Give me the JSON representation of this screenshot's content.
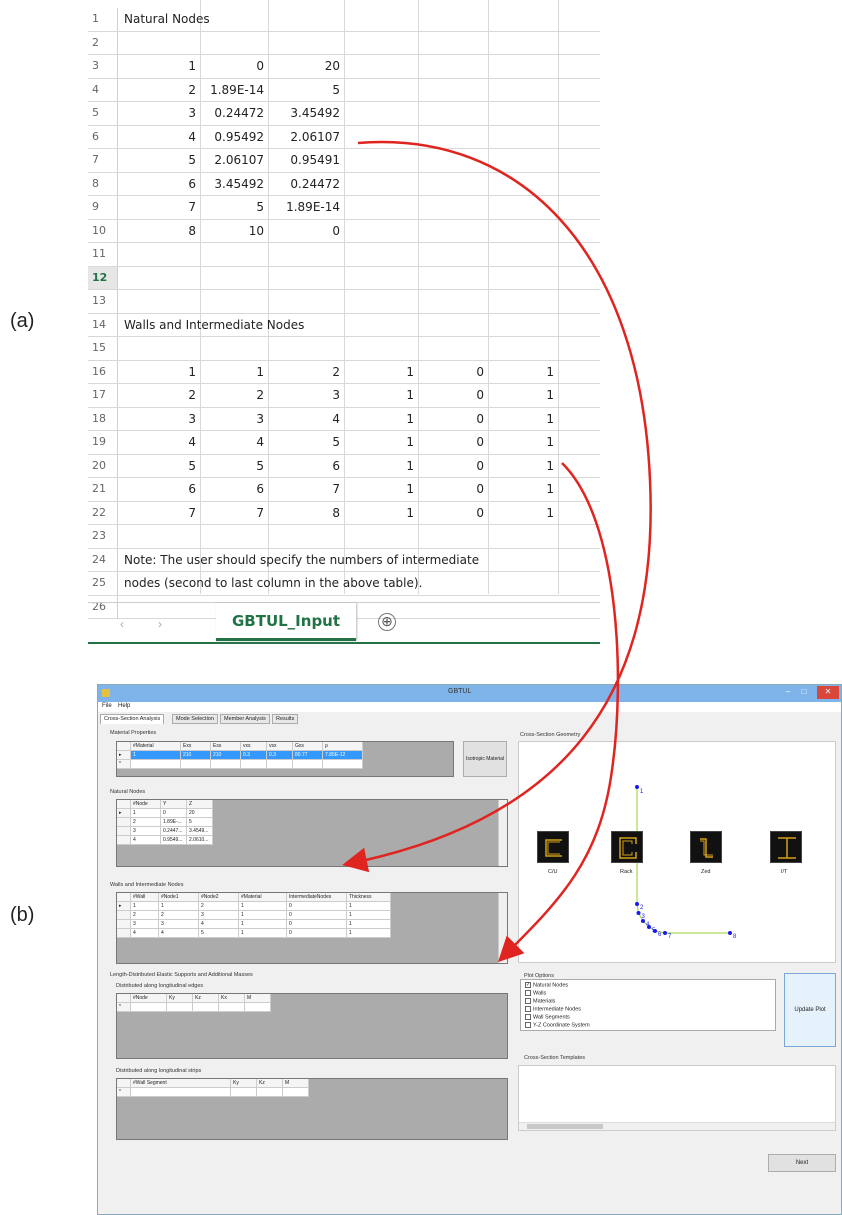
{
  "labels": {
    "a": "(a)",
    "b": "(b)"
  },
  "sheet": {
    "row_numbers": [
      "1",
      "2",
      "3",
      "4",
      "5",
      "6",
      "7",
      "8",
      "9",
      "10",
      "11",
      "12",
      "13",
      "14",
      "15",
      "16",
      "17",
      "18",
      "19",
      "20",
      "21",
      "22",
      "23",
      "24",
      "25",
      "26"
    ],
    "natural_title": "Natural Nodes",
    "natural_rows": [
      [
        "1",
        "0",
        "20"
      ],
      [
        "2",
        "1.89E-14",
        "5"
      ],
      [
        "3",
        "0.24472",
        "3.45492"
      ],
      [
        "4",
        "0.95492",
        "2.06107"
      ],
      [
        "5",
        "2.06107",
        "0.95491"
      ],
      [
        "6",
        "3.45492",
        "0.24472"
      ],
      [
        "7",
        "5",
        "1.89E-14"
      ],
      [
        "8",
        "10",
        "0"
      ]
    ],
    "walls_title": "Walls and Intermediate Nodes",
    "walls_rows": [
      [
        "1",
        "1",
        "2",
        "1",
        "0",
        "1"
      ],
      [
        "2",
        "2",
        "3",
        "1",
        "0",
        "1"
      ],
      [
        "3",
        "3",
        "4",
        "1",
        "0",
        "1"
      ],
      [
        "4",
        "4",
        "5",
        "1",
        "0",
        "1"
      ],
      [
        "5",
        "5",
        "6",
        "1",
        "0",
        "1"
      ],
      [
        "6",
        "6",
        "7",
        "1",
        "0",
        "1"
      ],
      [
        "7",
        "7",
        "8",
        "1",
        "0",
        "1"
      ]
    ],
    "note1": "Note: The user should specify the numbers of intermediate",
    "note2": "nodes (second to last column in the above table).",
    "tab_name": "GBTUL_Input",
    "nav_prev": "‹",
    "nav_next": "›",
    "add_icon": "⊕"
  },
  "window": {
    "title": "GBTUL",
    "menu": [
      "File",
      "Help"
    ],
    "tabs": [
      "Cross-Section Analysis",
      "Mode Selection",
      "Member Analysis",
      "Results"
    ],
    "material_group": "Material Properties",
    "material_headers": [
      "#Material",
      "Exx",
      "Ess",
      "vxs",
      "vsx",
      "Gxs",
      "ρ"
    ],
    "material_row": [
      "1",
      "210",
      "210",
      "0.3",
      "0.3",
      "80.77",
      "7.85E-12"
    ],
    "isotropic_button": "Isotropic Material",
    "natural_group": "Natural Nodes",
    "natural_headers": [
      "#Node",
      "Y",
      "Z"
    ],
    "natural_rows": [
      [
        "1",
        "0",
        "20"
      ],
      [
        "2",
        "1.89E-...",
        "5"
      ],
      [
        "3",
        "0.2447...",
        "3.4549..."
      ],
      [
        "4",
        "0.9549...",
        "2.0610..."
      ]
    ],
    "walls_group": "Walls and Intermediate Nodes",
    "walls_headers": [
      "#Wall",
      "#Node1",
      "#Node2",
      "#Material",
      "IntermediateNodes",
      "Thickness"
    ],
    "walls_rows": [
      [
        "1",
        "1",
        "2",
        "1",
        "0",
        "1"
      ],
      [
        "2",
        "2",
        "3",
        "1",
        "0",
        "1"
      ],
      [
        "3",
        "3",
        "4",
        "1",
        "0",
        "1"
      ],
      [
        "4",
        "4",
        "5",
        "1",
        "0",
        "1"
      ]
    ],
    "supports_group": "Length-Distributed Elastic Supports and Additional Masses",
    "edges_group": "Distributed along longitudinal edges",
    "edges_headers": [
      "#Node",
      "Ky",
      "Kz",
      "Kx",
      "M"
    ],
    "strips_group": "Distributed along longitudinal strips",
    "strips_headers": [
      "#Wall Segment",
      "Ky",
      "Kz",
      "M"
    ],
    "geometry_group": "Cross-Section Geometry",
    "plot_group": "Plot Options",
    "plot_options": [
      {
        "label": "Natural Nodes",
        "checked": true
      },
      {
        "label": "Walls",
        "checked": false
      },
      {
        "label": "Materials",
        "checked": false
      },
      {
        "label": "Intermediate Nodes",
        "checked": false
      },
      {
        "label": "Wall Segments",
        "checked": false
      },
      {
        "label": "Y-Z Coordinate System",
        "checked": false
      }
    ],
    "update_button": "Update Plot",
    "templates_group": "Cross-Section Templates",
    "templates": [
      "C/U",
      "Rack",
      "Zed",
      "I/T"
    ],
    "next_button": "Next",
    "node_labels": [
      "1",
      "2",
      "3",
      "4",
      "5",
      "6",
      "7",
      "8"
    ]
  },
  "colors": {
    "arrow": "#e0241f",
    "excel_green": "#217346",
    "title_bar": "#7eb4ea",
    "selection": "#3399ff",
    "wall_line": "#9acd32",
    "node": "#1a1aee",
    "template_line": "#d4a017"
  }
}
